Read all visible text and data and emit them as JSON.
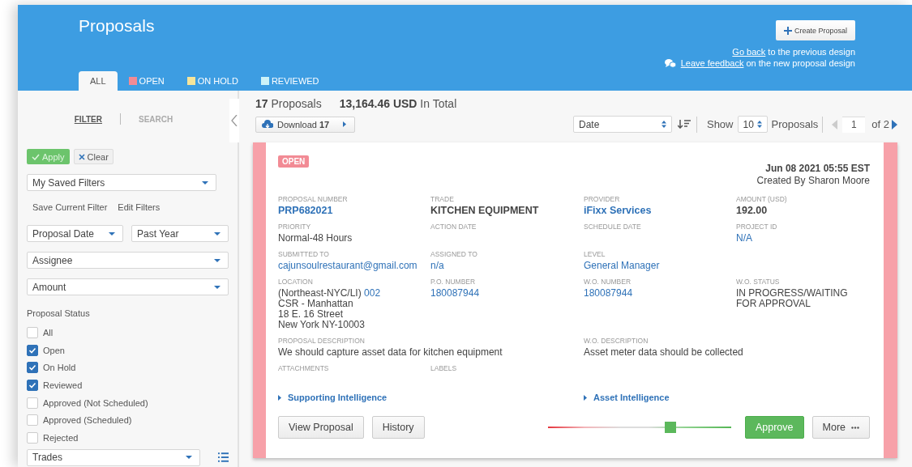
{
  "header": {
    "title": "Proposals",
    "create_button": "Create Proposal",
    "links": [
      {
        "link": "Go back",
        "rest": "to the previous design",
        "icon": false
      },
      {
        "link": "Leave feedback",
        "rest": "on the new proposal design",
        "icon": true
      }
    ]
  },
  "tabs": [
    {
      "label": "ALL",
      "selected": true
    },
    {
      "label": "OPEN",
      "selected": false,
      "color": "#f28b95"
    },
    {
      "label": "ON HOLD",
      "selected": false,
      "color": "#f6e59a"
    },
    {
      "label": "REVIEWED",
      "selected": false,
      "color": "#cdf3f8"
    }
  ],
  "sidebar": {
    "modes": [
      {
        "label": "FILTER",
        "selected": true
      },
      {
        "label": "SEARCH",
        "selected": false
      }
    ],
    "apply": "Apply",
    "clear": "Clear",
    "saved_filters": "My Saved Filters",
    "actions": [
      "Save Current Filter",
      "Edit Filters"
    ],
    "date_field": "Proposal Date",
    "date_range": "Past Year",
    "assignee": "Assignee",
    "amount": "Amount",
    "status_title": "Proposal Status",
    "statuses": [
      {
        "label": "All",
        "checked": false
      },
      {
        "label": "Open",
        "checked": true
      },
      {
        "label": "On Hold",
        "checked": true
      },
      {
        "label": "Reviewed",
        "checked": true
      },
      {
        "label": "Approved (Not Scheduled)",
        "checked": false
      },
      {
        "label": "Approved (Scheduled)",
        "checked": false
      },
      {
        "label": "Rejected",
        "checked": false
      }
    ],
    "trades": "Trades"
  },
  "summary": {
    "count": "17",
    "count_label": "Proposals",
    "total": "13,164.46 USD",
    "total_label": "In Total",
    "download_label": "Download",
    "download_count": "17",
    "sort": "Date",
    "show": "Show",
    "page_size": "10",
    "page_size_label": "Proposals",
    "page": "1",
    "page_of": "of 2"
  },
  "card": {
    "status": "OPEN",
    "date": "Jun 08 2021 05:55 EST",
    "created_by": "Created By Sharon Moore",
    "rows": [
      [
        {
          "label": "PROPOSAL NUMBER",
          "value": "PRP682021",
          "kind": "link-bold"
        },
        {
          "label": "TRADE",
          "value": "KITCHEN EQUIPMENT",
          "kind": "bold"
        },
        {
          "label": "PROVIDER",
          "value": "iFixx Services",
          "kind": "link-bold"
        },
        {
          "label": "AMOUNT (USD)",
          "value": "192.00",
          "kind": "bold"
        }
      ],
      [
        {
          "label": "PRIORITY",
          "value": "Normal-48 Hours",
          "kind": "text"
        },
        {
          "label": "ACTION DATE"
        },
        {
          "label": "SCHEDULE DATE"
        },
        {
          "label": "PROJECT ID",
          "value": "N/A",
          "kind": "link"
        }
      ],
      [
        {
          "label": "SUBMITTED TO",
          "value": "cajunsoulrestaurant@gmail.com",
          "kind": "link"
        },
        {
          "label": "ASSIGNED TO",
          "value": "n/a",
          "kind": "link"
        },
        {
          "label": "LEVEL",
          "value": "General Manager",
          "kind": "link"
        }
      ],
      [
        {
          "label": "LOCATION",
          "kind": "location",
          "prefix": "(Northeast-NYC/LI)",
          "link": "002",
          "lines": [
            "CSR - Manhattan",
            "18 E. 16 Street",
            "New York NY-10003"
          ]
        },
        {
          "label": "P.O. NUMBER",
          "value": "180087944",
          "kind": "link"
        },
        {
          "label": "W.O. NUMBER",
          "value": "180087944",
          "kind": "link"
        },
        {
          "label": "W.O. STATUS",
          "kind": "lines",
          "lines": [
            "IN PROGRESS/WAITING",
            "FOR APPROVAL"
          ]
        }
      ],
      [
        {
          "label": "ATTACHMENTS"
        },
        {
          "label": "LABELS"
        }
      ]
    ],
    "descriptions": [
      {
        "label": "PROPOSAL DESCRIPTION",
        "value": "We should capture asset data for kitchen equipment",
        "kind": "text"
      },
      {
        "label": "W.O. DESCRIPTION",
        "value": "Asset meter data should be collected",
        "kind": "text"
      }
    ],
    "expanders": [
      "Supporting Intelligence",
      "Asset Intelligence"
    ],
    "buttons": [
      "View Proposal",
      "History"
    ],
    "slider": {
      "level": 0.67
    },
    "approve": "Approve",
    "more": "More"
  }
}
